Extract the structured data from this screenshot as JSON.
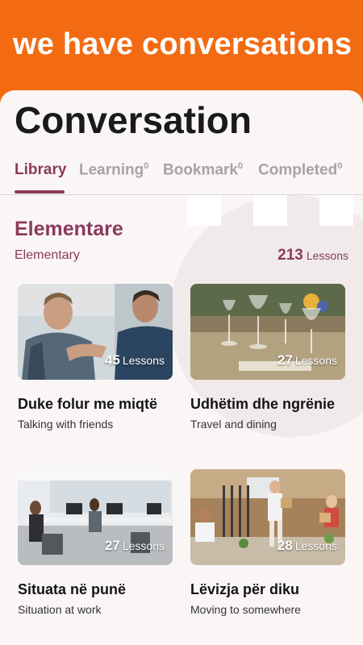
{
  "banner": {
    "title": "we have conversations"
  },
  "page": {
    "title": "Conversation"
  },
  "tabs": [
    {
      "label": "Library",
      "count": ""
    },
    {
      "label": "Learning",
      "count": "0"
    },
    {
      "label": "Bookmark",
      "count": "0"
    },
    {
      "label": "Completed",
      "count": "0"
    }
  ],
  "section": {
    "title": "Elementare",
    "subtitle": "Elementary",
    "lesson_count": "213",
    "lesson_word": "Lessons"
  },
  "courses": [
    {
      "title": "Duke folur me miqtë",
      "subtitle": "Talking with friends",
      "count": "45",
      "unit": "Lessons"
    },
    {
      "title": "Udhëtim dhe ngrënie",
      "subtitle": "Travel and dining",
      "count": "27",
      "unit": "Lessons"
    },
    {
      "title": "Situata në punë",
      "subtitle": "Situation at work",
      "count": "27",
      "unit": "Lessons"
    },
    {
      "title": "Lëvizja për diku",
      "subtitle": "Moving to somewhere",
      "count": "28",
      "unit": "Lessons"
    }
  ],
  "colors": {
    "banner": "#f26b12",
    "accent": "#8a3a5c",
    "inactive_tab": "#a7a3a3"
  }
}
